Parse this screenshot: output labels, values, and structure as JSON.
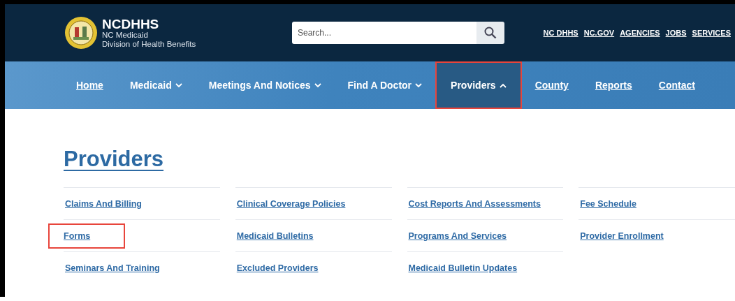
{
  "header": {
    "brand": "NCDHHS",
    "subtitle_lines": [
      "NC Medicaid",
      "Division of Health Benefits"
    ],
    "search": {
      "placeholder": "Search..."
    },
    "utility_links": [
      "NC DHHS",
      "NC.GOV",
      "AGENCIES",
      "JOBS",
      "SERVICES"
    ]
  },
  "nav": [
    {
      "label": "Home",
      "kind": "link",
      "expanded": false,
      "highlighted": false
    },
    {
      "label": "Medicaid",
      "kind": "dropdown",
      "expanded": false,
      "highlighted": false
    },
    {
      "label": "Meetings And Notices",
      "kind": "dropdown",
      "expanded": false,
      "highlighted": false
    },
    {
      "label": "Find A Doctor",
      "kind": "dropdown",
      "expanded": false,
      "highlighted": false
    },
    {
      "label": "Providers",
      "kind": "dropdown",
      "expanded": true,
      "highlighted": true
    },
    {
      "label": "County",
      "kind": "link",
      "expanded": false,
      "highlighted": false
    },
    {
      "label": "Reports",
      "kind": "link",
      "expanded": false,
      "highlighted": false
    },
    {
      "label": "Contact",
      "kind": "link",
      "expanded": false,
      "highlighted": false
    }
  ],
  "page_title": "Providers",
  "link_columns": [
    [
      {
        "label": "Claims And Billing",
        "highlighted": false
      },
      {
        "label": "Forms",
        "highlighted": true
      },
      {
        "label": "Seminars And Training",
        "highlighted": false
      }
    ],
    [
      {
        "label": "Clinical Coverage Policies",
        "highlighted": false
      },
      {
        "label": "Medicaid Bulletins",
        "highlighted": false
      },
      {
        "label": "Excluded Providers",
        "highlighted": false
      }
    ],
    [
      {
        "label": "Cost Reports And Assessments",
        "highlighted": false
      },
      {
        "label": "Programs And Services",
        "highlighted": false
      },
      {
        "label": "Medicaid Bulletin Updates",
        "highlighted": false
      }
    ],
    [
      {
        "label": "Fee Schedule",
        "highlighted": false
      },
      {
        "label": "Provider Enrollment",
        "highlighted": false
      }
    ]
  ]
}
